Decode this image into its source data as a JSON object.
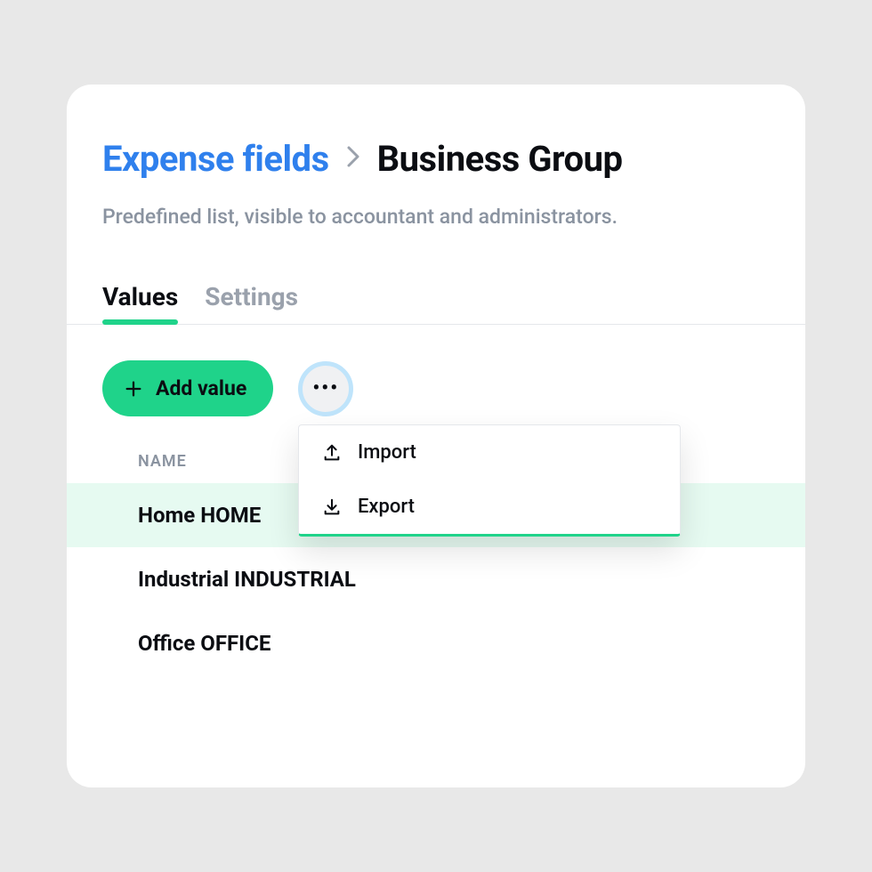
{
  "breadcrumb": {
    "parent": "Expense fields",
    "current": "Business Group"
  },
  "subtitle": "Predefined list, visible to accountant and administrators.",
  "tabs": [
    {
      "label": "Values",
      "active": true
    },
    {
      "label": "Settings",
      "active": false
    }
  ],
  "toolbar": {
    "add_label": "Add value"
  },
  "dropdown": {
    "import_label": "Import",
    "export_label": "Export"
  },
  "table": {
    "header": "NAME",
    "rows": [
      {
        "label": "Home HOME",
        "highlighted": true
      },
      {
        "label": "Industrial INDUSTRIAL",
        "highlighted": false
      },
      {
        "label": "Office OFFICE",
        "highlighted": false
      }
    ]
  }
}
